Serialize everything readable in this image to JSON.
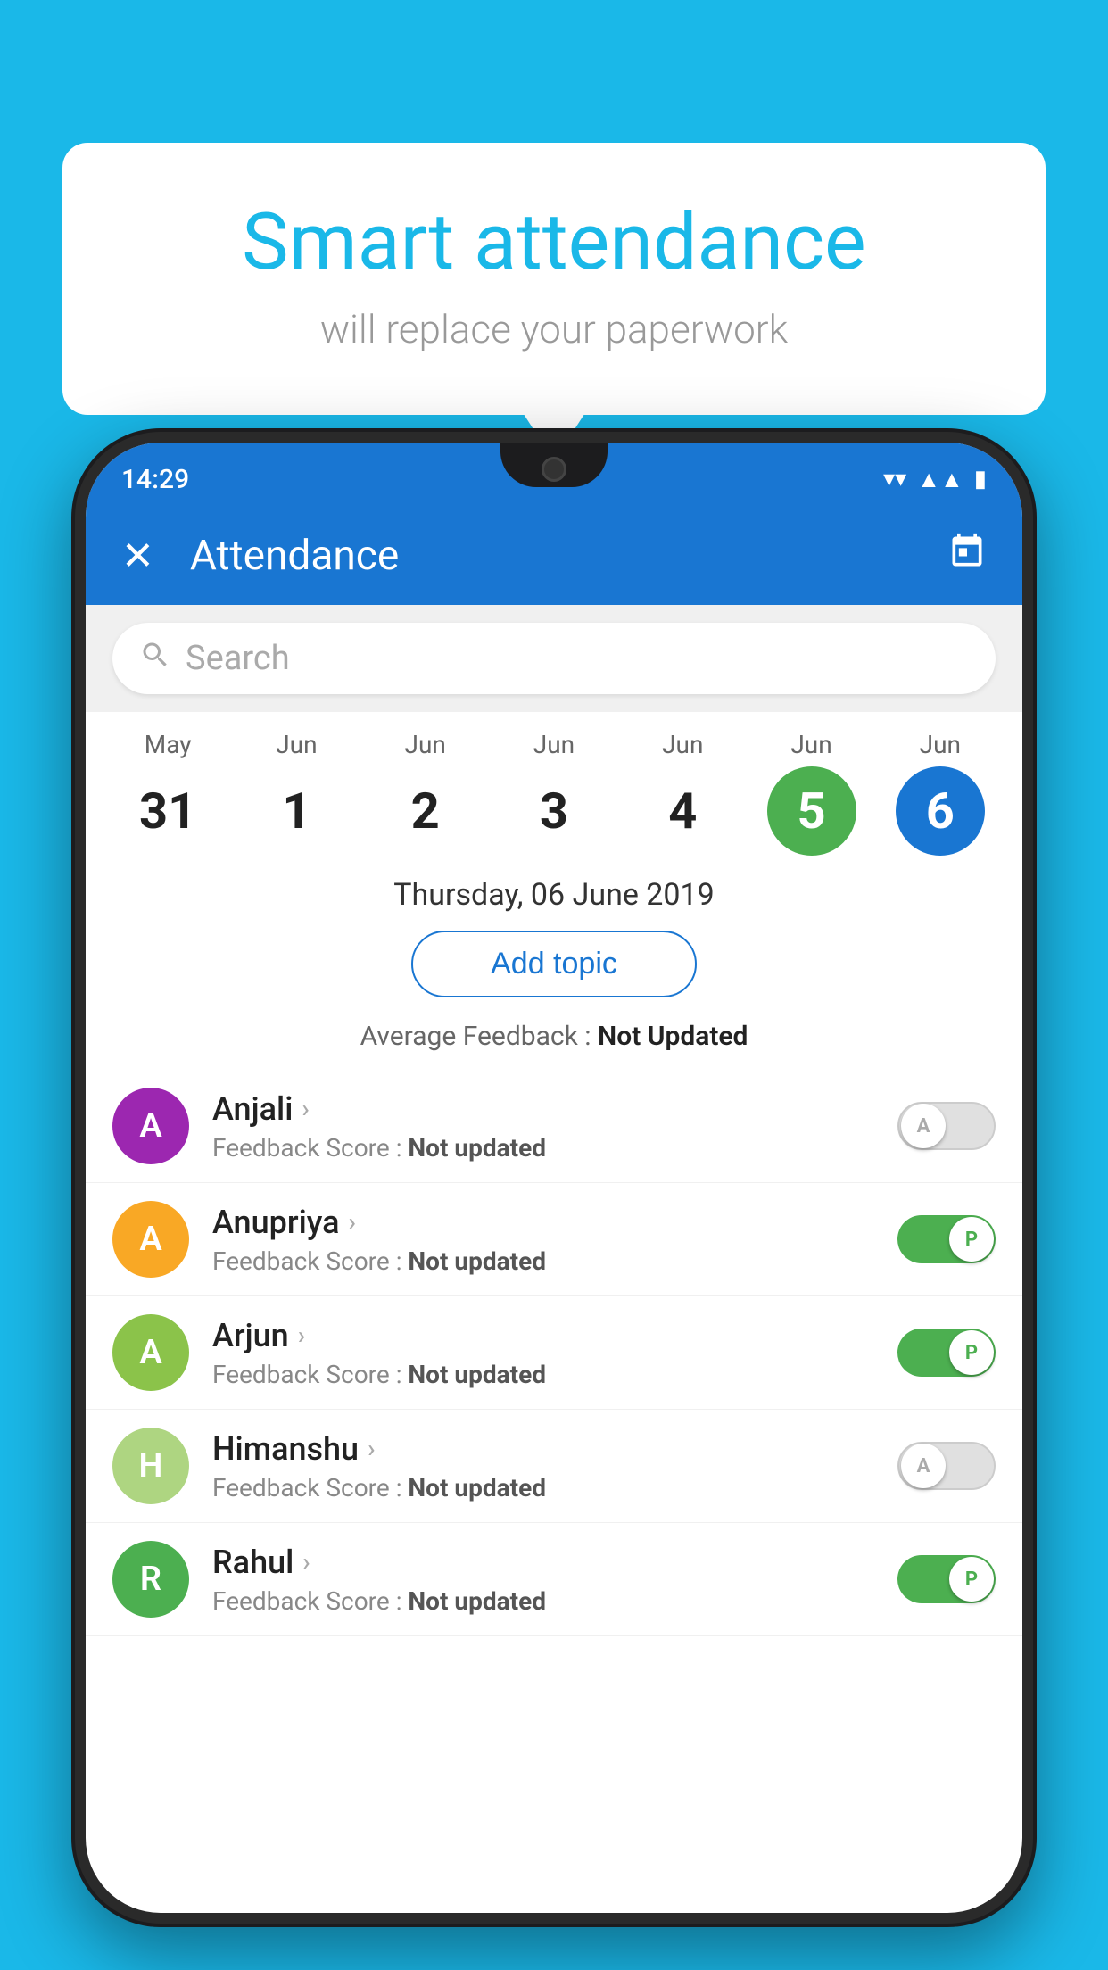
{
  "background_color": "#1ab8e8",
  "speech_bubble": {
    "title": "Smart attendance",
    "subtitle": "will replace your paperwork"
  },
  "status_bar": {
    "time": "14:29",
    "icons": [
      "wifi",
      "signal",
      "battery"
    ]
  },
  "app_bar": {
    "close_icon": "✕",
    "title": "Attendance",
    "calendar_icon": "📅"
  },
  "search": {
    "placeholder": "Search"
  },
  "calendar": {
    "days": [
      {
        "month": "May",
        "date": "31",
        "state": "normal"
      },
      {
        "month": "Jun",
        "date": "1",
        "state": "normal"
      },
      {
        "month": "Jun",
        "date": "2",
        "state": "normal"
      },
      {
        "month": "Jun",
        "date": "3",
        "state": "normal"
      },
      {
        "month": "Jun",
        "date": "4",
        "state": "normal"
      },
      {
        "month": "Jun",
        "date": "5",
        "state": "today"
      },
      {
        "month": "Jun",
        "date": "6",
        "state": "selected"
      }
    ]
  },
  "selected_date": "Thursday, 06 June 2019",
  "add_topic_label": "Add topic",
  "avg_feedback_label": "Average Feedback :",
  "avg_feedback_value": "Not Updated",
  "students": [
    {
      "name": "Anjali",
      "initial": "A",
      "avatar_color": "#9c27b0",
      "feedback_label": "Feedback Score :",
      "feedback_value": "Not updated",
      "attendance": "absent",
      "toggle_label": "A"
    },
    {
      "name": "Anupriya",
      "initial": "A",
      "avatar_color": "#f9a825",
      "feedback_label": "Feedback Score :",
      "feedback_value": "Not updated",
      "attendance": "present",
      "toggle_label": "P"
    },
    {
      "name": "Arjun",
      "initial": "A",
      "avatar_color": "#8bc34a",
      "feedback_label": "Feedback Score :",
      "feedback_value": "Not updated",
      "attendance": "present",
      "toggle_label": "P"
    },
    {
      "name": "Himanshu",
      "initial": "H",
      "avatar_color": "#aed581",
      "feedback_label": "Feedback Score :",
      "feedback_value": "Not updated",
      "attendance": "absent",
      "toggle_label": "A"
    },
    {
      "name": "Rahul",
      "initial": "R",
      "avatar_color": "#4caf50",
      "feedback_label": "Feedback Score :",
      "feedback_value": "Not updated",
      "attendance": "present",
      "toggle_label": "P"
    }
  ]
}
